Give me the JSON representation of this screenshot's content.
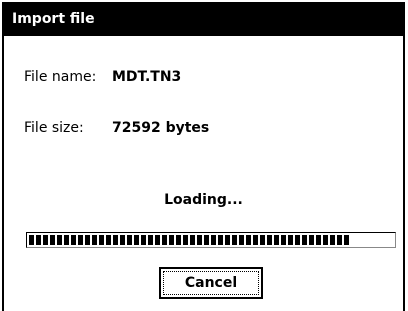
{
  "window": {
    "title": "Import file"
  },
  "file": {
    "name_label": "File name:",
    "name_value": "MDT.TN3",
    "size_label": "File size:",
    "size_value": "72592 bytes"
  },
  "status": {
    "text": "Loading..."
  },
  "progress": {
    "fraction": 0.88
  },
  "buttons": {
    "cancel_label": "Cancel"
  }
}
